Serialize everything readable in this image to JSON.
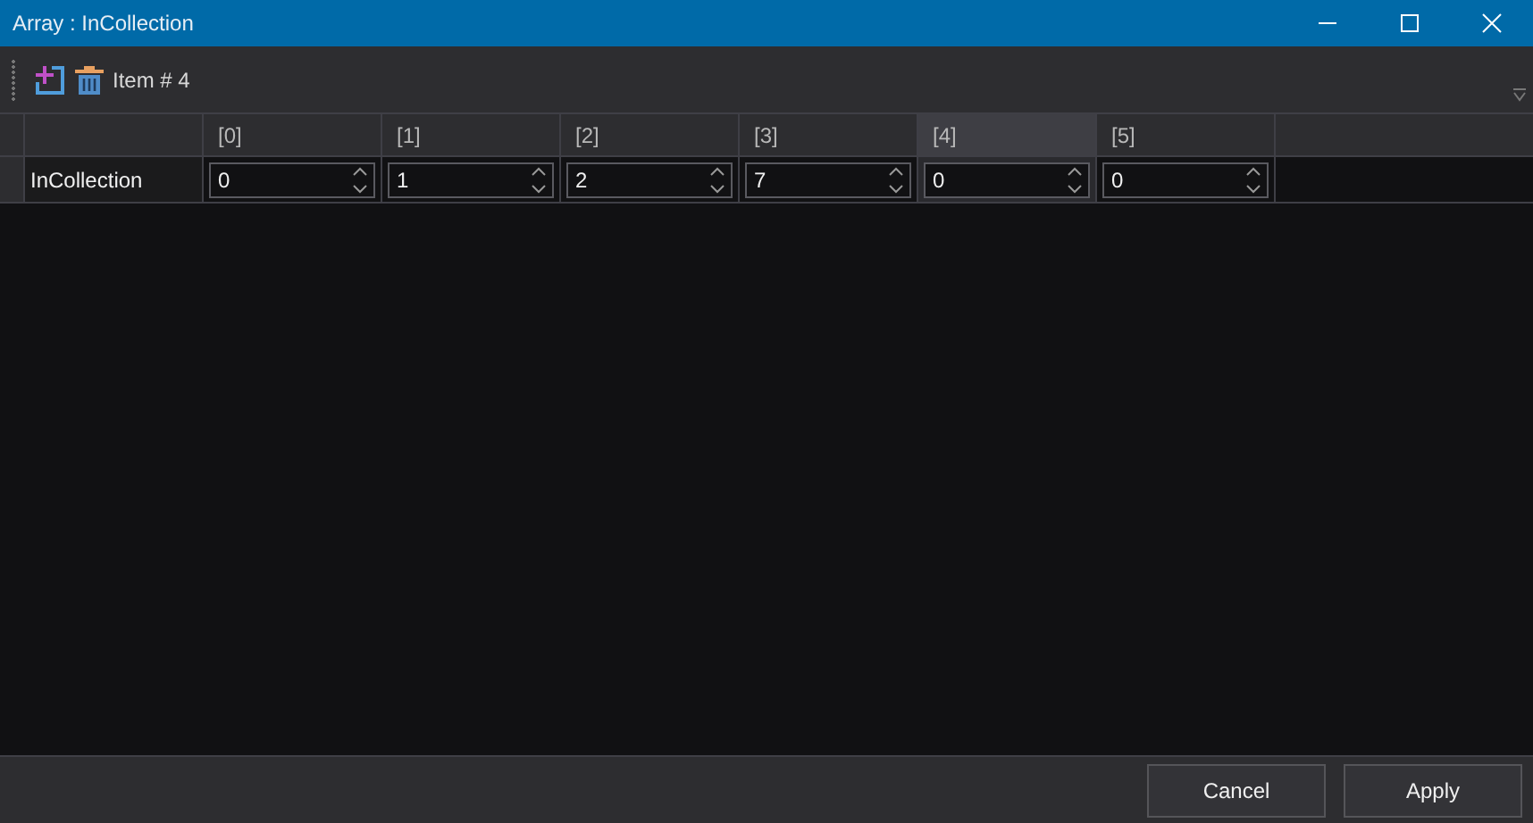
{
  "window": {
    "title": "Array : InCollection"
  },
  "toolbar": {
    "item_label": "Item # 4"
  },
  "grid": {
    "columns": [
      {
        "label": "[0]",
        "selected": false
      },
      {
        "label": "[1]",
        "selected": false
      },
      {
        "label": "[2]",
        "selected": false
      },
      {
        "label": "[3]",
        "selected": false
      },
      {
        "label": "[4]",
        "selected": true
      },
      {
        "label": "[5]",
        "selected": false
      }
    ],
    "rows": [
      {
        "name": "InCollection",
        "values": [
          "0",
          "1",
          "2",
          "7",
          "0",
          "0"
        ]
      }
    ]
  },
  "buttons": [
    "Cancel",
    "Apply"
  ]
}
